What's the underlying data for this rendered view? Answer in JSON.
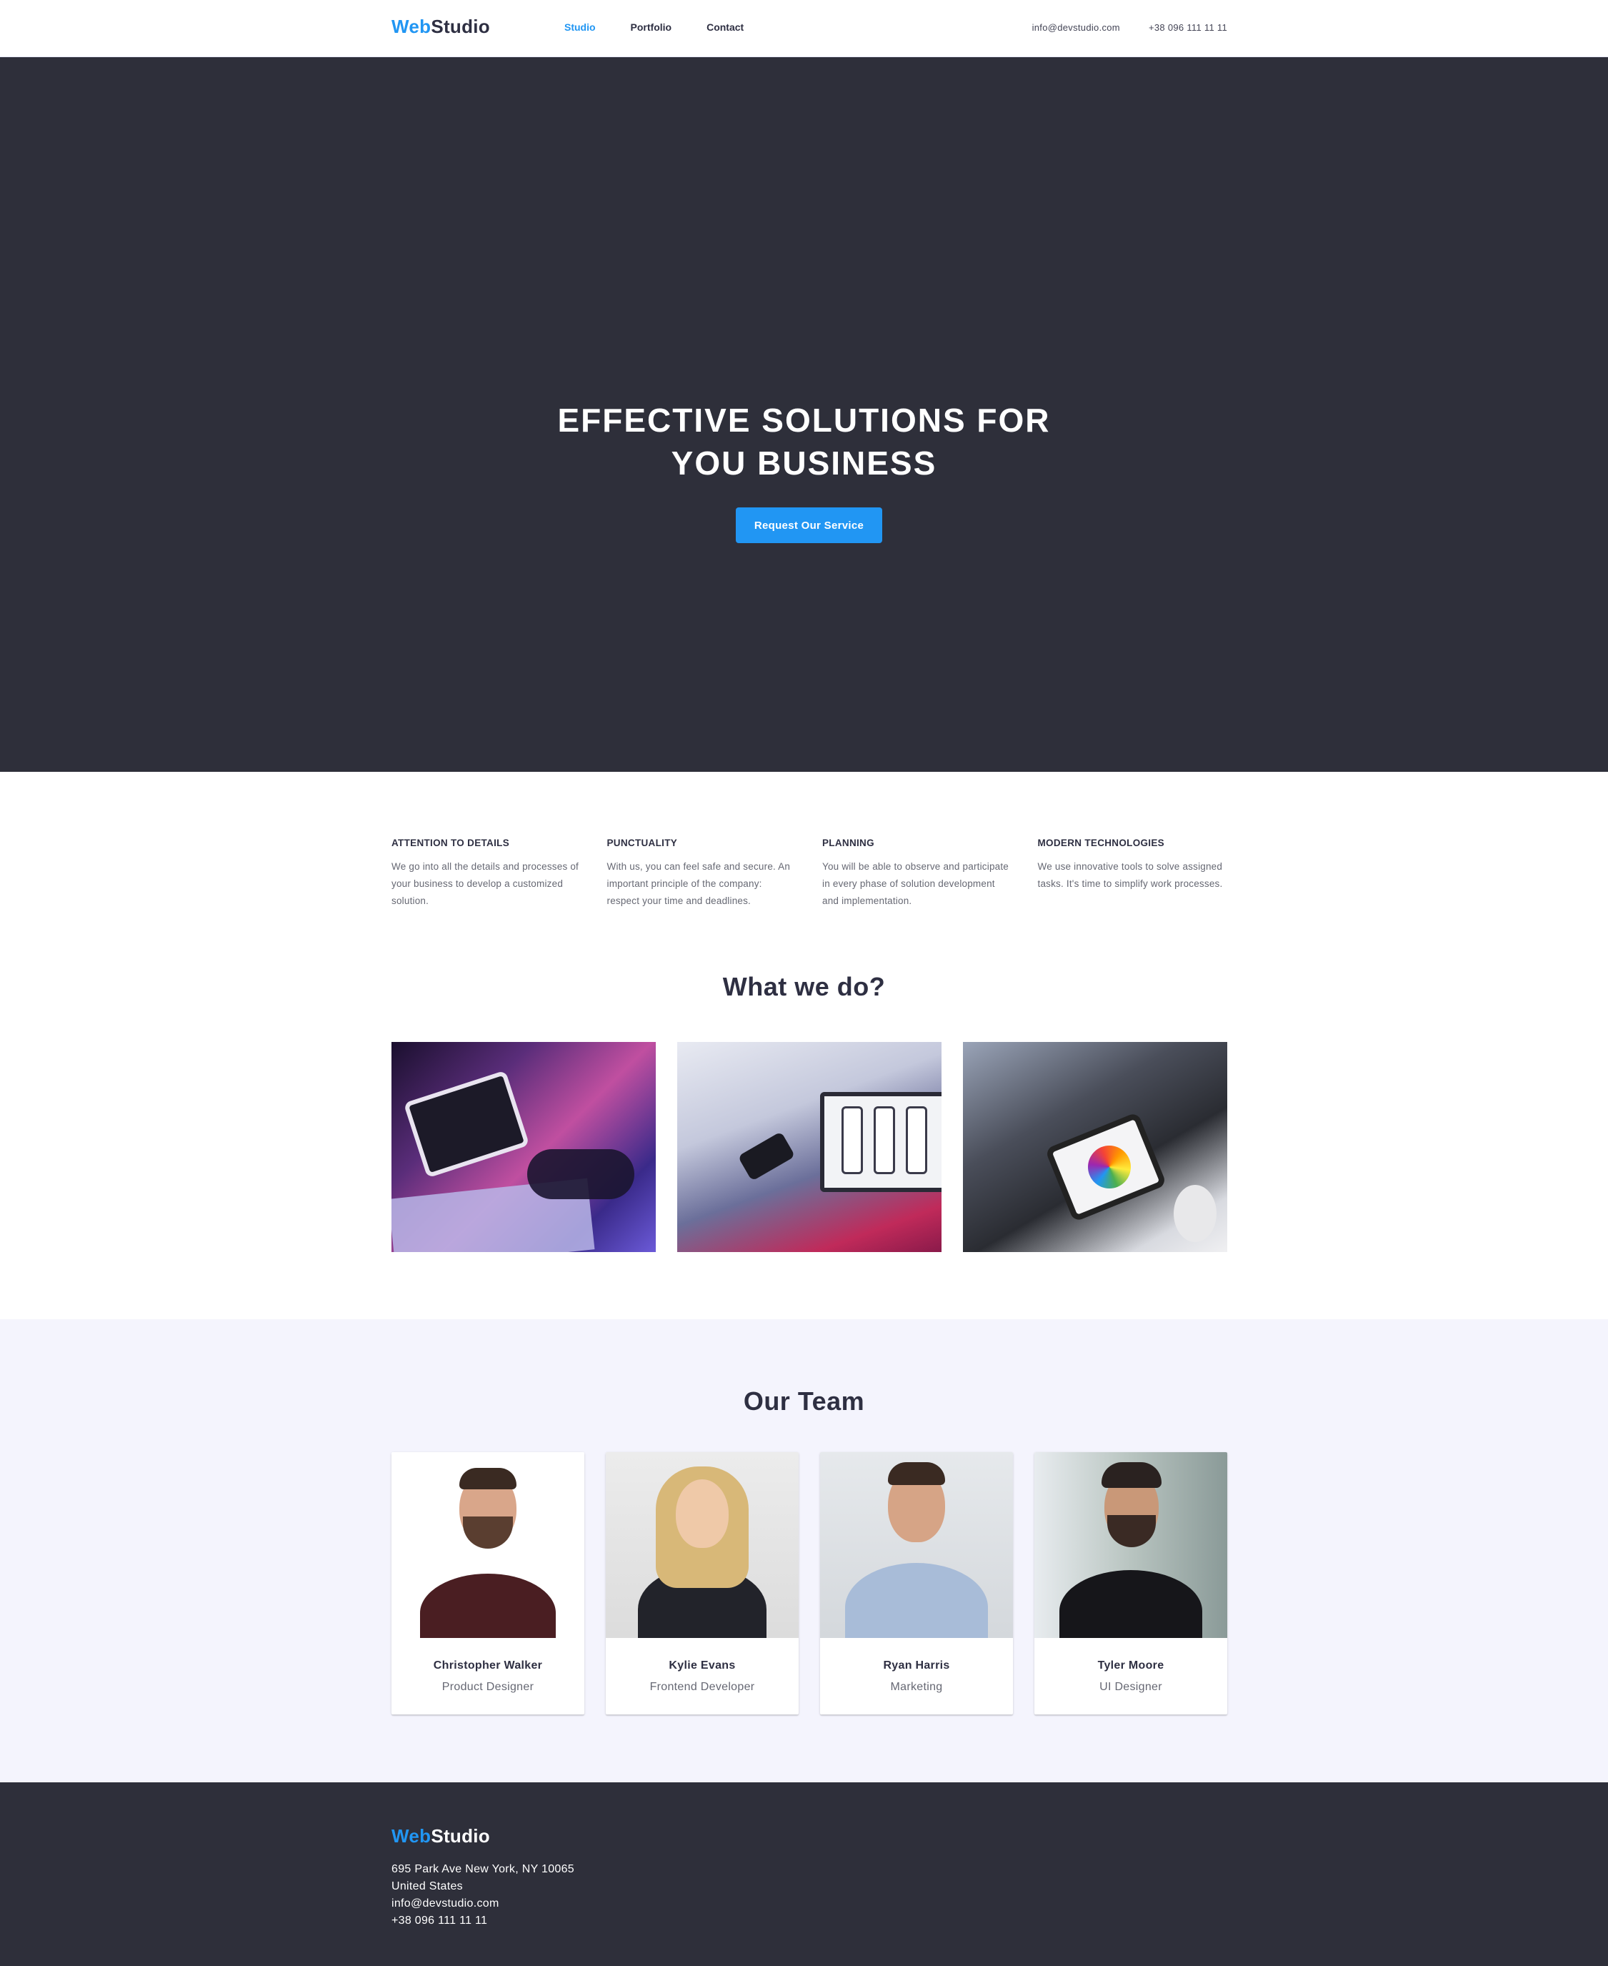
{
  "header": {
    "logo_accent": "Web",
    "logo_rest": "Studio",
    "nav": [
      {
        "label": "Studio",
        "active": true
      },
      {
        "label": "Portfolio",
        "active": false
      },
      {
        "label": "Contact",
        "active": false
      }
    ],
    "email": "info@devstudio.com",
    "phone": "+38 096 111 11 11"
  },
  "hero": {
    "title_line1": "EFFECTIVE SOLUTIONS FOR",
    "title_line2": "YOU BUSINESS",
    "button_label": "Request Our Service"
  },
  "features": [
    {
      "title": "ATTENTION TO DETAILS",
      "text": "We go into all the details and processes of your business to develop a customized solution."
    },
    {
      "title": "PUNCTUALITY",
      "text": "With us, you can feel safe and secure. An important principle of the company: respect your time and deadlines."
    },
    {
      "title": "PLANNING",
      "text": "You will be able to observe and participate in every phase of solution development and implementation."
    },
    {
      "title": "MODERN TECHNOLOGIES",
      "text": "We use innovative tools to solve assigned tasks. It's time to simplify work processes."
    }
  ],
  "what_we_do": {
    "title": "What we do?"
  },
  "team": {
    "title": "Our Team",
    "members": [
      {
        "name": "Christopher Walker",
        "role": "Product Designer"
      },
      {
        "name": "Kylie Evans",
        "role": "Frontend Developer"
      },
      {
        "name": "Ryan Harris",
        "role": "Marketing"
      },
      {
        "name": "Tyler Moore",
        "role": "UI Designer"
      }
    ]
  },
  "footer": {
    "logo_accent": "Web",
    "logo_rest": "Studio",
    "address_line1": "695 Park Ave New York, NY 10065",
    "address_line2": "United States",
    "email": "info@devstudio.com",
    "phone": "+38 096 111 11 11"
  },
  "colors": {
    "accent": "#2196f3",
    "dark": "#2e2f3a",
    "team_bg": "#f4f4fd"
  }
}
